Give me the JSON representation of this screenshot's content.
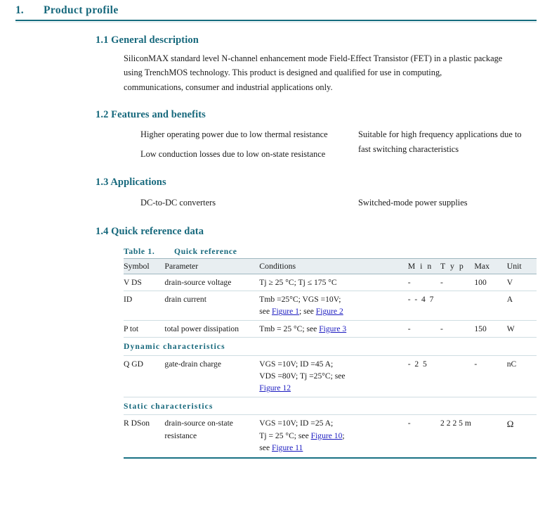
{
  "section": {
    "number": "1.",
    "title": "Product profile"
  },
  "general_description": {
    "heading": "1.1 General description",
    "text": "SiliconMAX standard level N-channel enhancement mode Field-Effect Transistor (FET) in a plastic package using TrenchMOS technology. This product is designed and qualified for use in computing, communications, consumer and industrial applications only."
  },
  "features": {
    "heading": "1.2 Features and benefits",
    "left": [
      "Higher operating power due to low thermal resistance",
      "Low conduction losses due to low on-state resistance"
    ],
    "right": [
      "Suitable for high frequency applications due to fast switching characteristics"
    ]
  },
  "applications": {
    "heading": "1.3 Applications",
    "left": [
      "DC-to-DC converters"
    ],
    "right": [
      "Switched-mode power supplies"
    ]
  },
  "quick_reference": {
    "heading": "1.4 Quick reference data",
    "table_label": "Table 1.",
    "table_title": "Quick reference",
    "columns": {
      "symbol": "Symbol",
      "parameter": "Parameter",
      "conditions": "Conditions",
      "min": "M i n",
      "typ": "T y p",
      "max": "Max",
      "unit": "Unit"
    },
    "rows": [
      {
        "symbol": "V DS",
        "parameter": "drain-source voltage",
        "conditions_plain": "Tj ≥ 25 °C; Tj ≤ 175 °C",
        "min": "-",
        "typ": "-",
        "max": "100",
        "unit": "V"
      },
      {
        "symbol": "ID",
        "parameter": "drain current",
        "conditions_plain": "Tmb =25°C; VGS =10V;",
        "conditions_line2_prefix": "see ",
        "conditions_link1": "Figure 1",
        "conditions_mid": "; see ",
        "conditions_link2": "Figure 2",
        "min": "-  -  4  7",
        "typ": "",
        "max": "",
        "unit": "A"
      },
      {
        "symbol": "P tot",
        "parameter": "total power dissipation",
        "conditions_plain": "Tmb = 25 °C; see ",
        "conditions_link1": "Figure 3",
        "min": "-",
        "typ": "-",
        "max": "150",
        "unit": "W"
      }
    ],
    "dynamic_section_label": "Dynamic characteristics",
    "dynamic_rows": [
      {
        "symbol": "Q GD",
        "parameter": "gate-drain charge",
        "conditions_plain": "VGS =10V; ID =45 A;",
        "conditions_line2": "VDS =80V; Tj =25°C; see",
        "conditions_link1": "Figure 12",
        "min": "-  2  5",
        "typ": "",
        "max": "-",
        "unit": "nC"
      }
    ],
    "static_section_label": "Static characteristics",
    "static_rows": [
      {
        "symbol": "R DSon",
        "parameter": "drain-source on-state resistance",
        "conditions_plain": "VGS =10V; ID =25 A;",
        "conditions_line2_prefix": "Tj = 25 °C; see ",
        "conditions_link1": "Figure 10",
        "conditions_line2_suffix": ";",
        "conditions_line3_prefix": "see ",
        "conditions_link2": "Figure 11",
        "min": "-",
        "typ": "2 2 2 5 m",
        "max": "",
        "unit": "Ω"
      }
    ]
  },
  "colors": {
    "teal": "#16687c",
    "link": "#1a1ac0",
    "header_bg": "#e8eef1",
    "rule": "#1a7285"
  }
}
